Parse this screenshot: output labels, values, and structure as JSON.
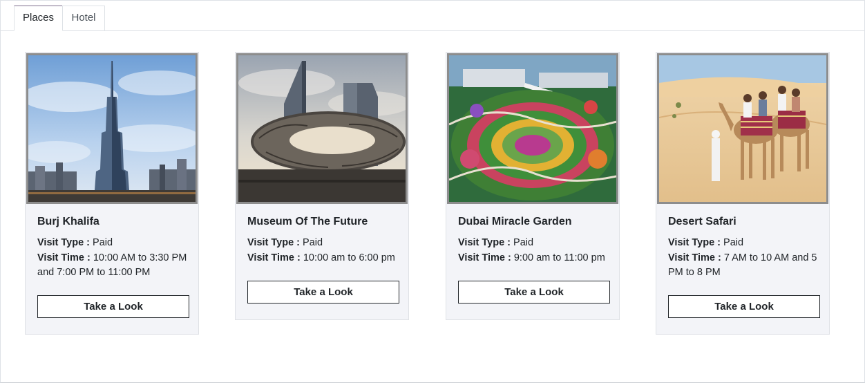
{
  "tabs": [
    {
      "label": "Places",
      "active": true
    },
    {
      "label": "Hotel",
      "active": false
    }
  ],
  "labels": {
    "visit_type": "Visit Type :",
    "visit_time": "Visit Time :"
  },
  "places": [
    {
      "name": "Burj Khalifa",
      "visit_type": "Paid",
      "visit_time": "10:00 AM to 3:30 PM and 7:00 PM to 11:00 PM",
      "button": "Take a Look",
      "image": "burj-khalifa-photo"
    },
    {
      "name": "Museum Of The Future",
      "visit_type": "Paid",
      "visit_time": "10:00 am to 6:00 pm",
      "button": "Take a Look",
      "image": "museum-of-the-future-photo"
    },
    {
      "name": "Dubai Miracle Garden",
      "visit_type": "Paid",
      "visit_time": "9:00 am to 11:00 pm",
      "button": "Take a Look",
      "image": "miracle-garden-photo"
    },
    {
      "name": "Desert Safari",
      "visit_type": "Paid",
      "visit_time": "7 AM to 10 AM and 5 PM to 8 PM",
      "button": "Take a Look",
      "image": "desert-safari-photo"
    }
  ],
  "colors": {
    "card_bg": "#f3f4f8",
    "active_tab_top": "#7c6b8a",
    "image_border": "#8d8d8d"
  }
}
